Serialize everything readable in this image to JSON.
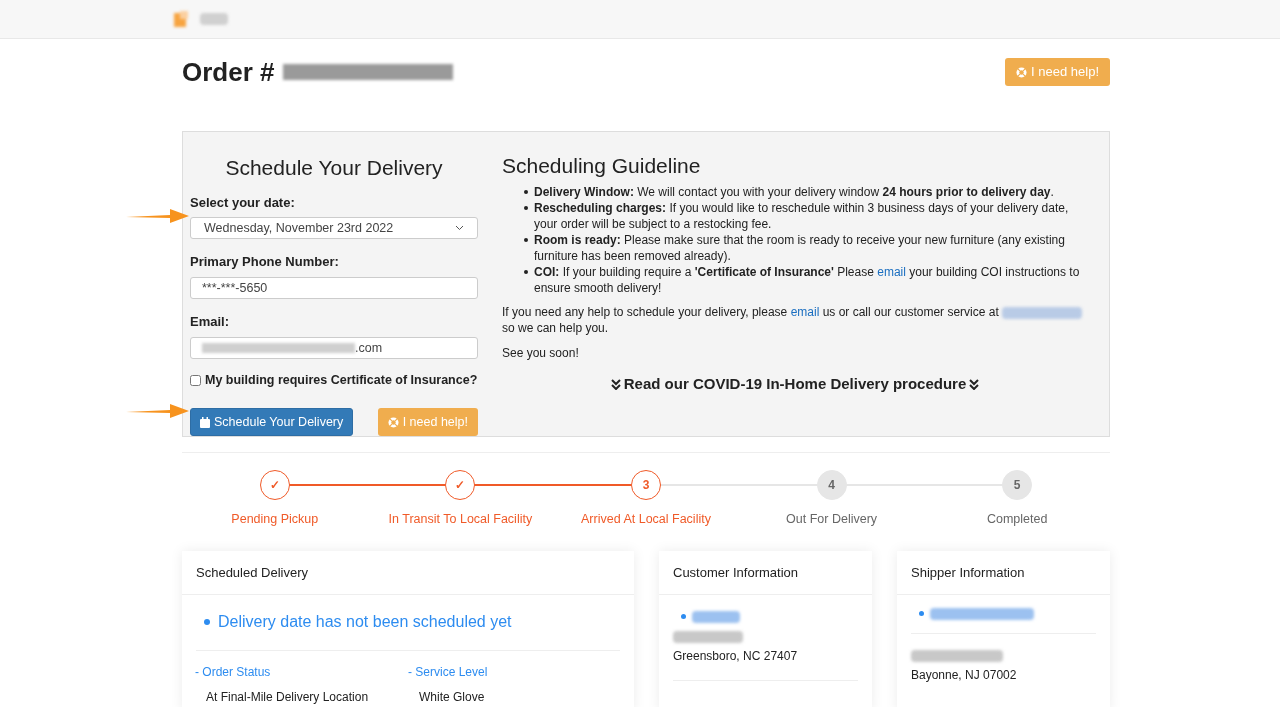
{
  "order": {
    "title": "Order #",
    "help_button": "I need help!"
  },
  "form": {
    "title": "Schedule Your Delivery",
    "date_label": "Select your date:",
    "date_value": "Wednesday, November 23rd 2022",
    "phone_label": "Primary Phone Number:",
    "phone_value": "***-***-5650",
    "email_label": "Email:",
    "email_visible": ".com",
    "coi": {
      "label": "My building requires Certificate of Insurance?",
      "checked": false
    },
    "submit_button": "Schedule Your Delivery",
    "help_button": "I need help!"
  },
  "guideline": {
    "title": "Scheduling Guideline",
    "items": [
      [
        {
          "kind": "text",
          "text": "**Delivery Window:** We will contact you with your delivery window **24 hours prior to delivery day**."
        }
      ],
      [
        {
          "kind": "text",
          "text": "**Rescheduling charges:** If you would like to reschedule within 3 business days of your delivery date, your order will be subject to a restocking fee."
        }
      ],
      [
        {
          "kind": "text",
          "text": "**Room is ready:** Please make sure that the room is ready to receive your new furniture (any existing furniture has been removed already)."
        }
      ],
      [
        {
          "kind": "text",
          "text": "**COI:** If your building require a **'Certificate of Insurance'** Please"
        },
        {
          "kind": "link",
          "text": "email"
        },
        {
          "kind": "text",
          "text": "your building COI instructions to ensure smooth delivery!"
        }
      ]
    ],
    "help": [
      {
        "kind": "text",
        "text": "If you need any help to schedule your delivery, please"
      },
      {
        "kind": "link",
        "text": "email"
      },
      {
        "kind": "text",
        "text": "us or call our customer service at"
      },
      {
        "kind": "redacted"
      },
      {
        "kind": "text",
        "text": "so we can help you."
      }
    ],
    "closing": "See you soon!",
    "covid_link": "Read our COVID-19 In-Home Delivery procedure"
  },
  "steps": [
    {
      "label": "Pending Pickup",
      "mark": "✓",
      "kind": "done"
    },
    {
      "label": "In Transit To Local Facility",
      "mark": "✓",
      "kind": "done"
    },
    {
      "label": "Arrived At Local Facility",
      "mark": "3",
      "kind": "current"
    },
    {
      "label": "Out For Delivery",
      "mark": "4",
      "kind": "pending"
    },
    {
      "label": "Completed",
      "mark": "5",
      "kind": "pending"
    }
  ],
  "scheduled": {
    "title": "Scheduled Delivery",
    "status": "Delivery date has not been scheduled yet",
    "fields": [
      {
        "label": "- Order Status",
        "value": "At Final-Mile Delivery Location"
      },
      {
        "label": "- Service Level",
        "value": "White Glove"
      }
    ]
  },
  "customer": {
    "title": "Customer Information",
    "address_line": "Greensboro, NC 27407"
  },
  "shipper": {
    "title": "Shipper Information",
    "address_line": "Bayonne, NJ 07002"
  }
}
